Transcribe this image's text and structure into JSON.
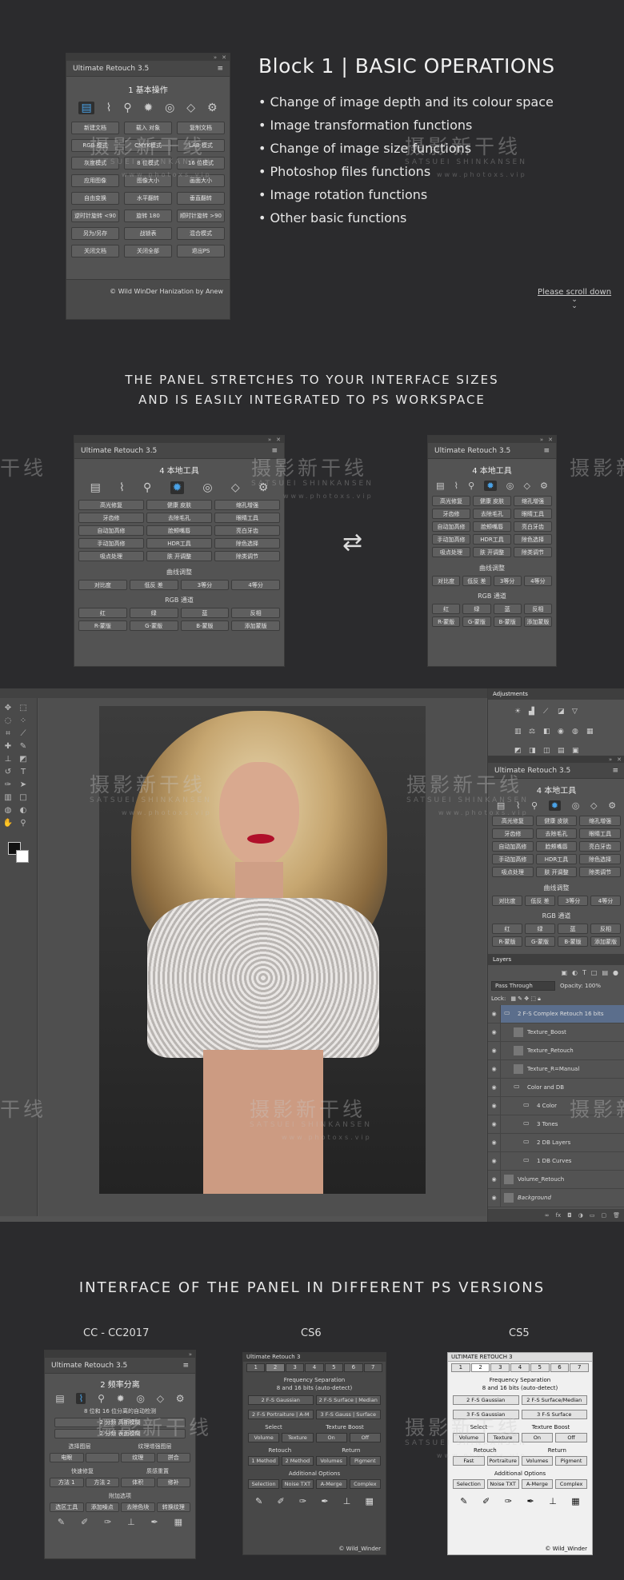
{
  "block1": {
    "panel_title": "Ultimate Retouch 3.5",
    "subtitle": "1 基本操作",
    "buttons": [
      "新建文档",
      "载入 对象",
      "复制文档",
      "RGB 模式",
      "CMYK模式",
      "LAB 模式",
      "灰度模式",
      "8 位模式",
      "16 位模式",
      "应用图像",
      "图像大小",
      "画面大小",
      "自由变换",
      "水平翻转",
      "垂直翻转",
      "逆时针旋转 <90",
      "旋转 180",
      "顺时针旋转 >90",
      "另为/另存",
      "战锁表",
      "混合模式",
      "关闭文档",
      "关闭全部",
      "退出PS"
    ],
    "footer": "© Wild WinDer Hanization by Anew",
    "heading": "Block 1 | BASIC OPERATIONS",
    "bullets": [
      "• Change of image depth  and its colour space",
      "• Image transformation functions",
      "• Change of image size functions",
      "• Photoshop files functions",
      "• Image rotation functions",
      "• Other basic functions"
    ],
    "scroll": "Please scroll down"
  },
  "block2": {
    "heading_1": "THE PANEL STRETCHES TO YOUR INTERFACE SIZES",
    "heading_2": "AND IS EASILY INTEGRATED TO PS WORKSPACE",
    "panel_title": "Ultimate Retouch 3.5",
    "subtitle": "4 本地工具",
    "tools": [
      "高光修复",
      "健康 皮肤",
      "缩孔增强",
      "牙齿修",
      "去除毛孔",
      "眼睛工具",
      "自动加高修",
      "脸颊嘴唇",
      "亮白牙齿",
      "手动加高修",
      "HDR工具",
      "除色选择",
      "吸点处理",
      "肤 开调整",
      "除类调节"
    ],
    "curves": "曲线调整",
    "curve_buttons": [
      "对比度",
      "低反 差",
      "3等分",
      "4等分"
    ],
    "rgb": "RGB 通道",
    "rgb_buttons": [
      "红",
      "绿",
      "蓝",
      "反相",
      "R-蒙版",
      "G-蒙版",
      "B-蒙版",
      "添加蒙版"
    ]
  },
  "block3": {
    "adjustments": "Adjustments",
    "panel_title": "Ultimate Retouch 3.5",
    "subtitle": "4 本地工具",
    "layers_tab": "Layers",
    "blend": "Pass Through",
    "opacity": "Opacity: 100%",
    "lock": "Lock:",
    "fill": "Fill: 100%",
    "layers": [
      "2 F-S Complex Retouch 16 bits",
      "Texture_Boost",
      "Texture_Retouch",
      "Texture_R=Manual",
      "Color and DB",
      "4 Color",
      "3 Tones",
      "2 DB Layers",
      "1 DB Curves",
      "Volume_Retouch",
      "Background"
    ]
  },
  "block4": {
    "heading": "INTERFACE OF THE PANEL IN DIFFERENT PS VERSIONS",
    "versions": [
      "CC - CC2017",
      "CS6",
      "CS5"
    ],
    "cc": {
      "title": "Ultimate Retouch 3.5",
      "subtitle": "2 频率分离",
      "rows": [
        "8 位和 16 位分离的自动检测",
        "2 分频 高斯模糊",
        "2 分频 表面模糊",
        "2 分频 修复模糊",
        "3 分频 表面模糊"
      ],
      "sel": "选择图层",
      "tex": "纹理增强图层",
      "b1": [
        "电眼",
        ""
      ],
      "b2": [
        "纹理",
        "拼合"
      ],
      "fast": "快速修复",
      "vol": "质感重置",
      "b3": [
        "方法 1",
        "方法 2",
        "体积",
        "修补"
      ],
      "extra": "附加选项",
      "b4": [
        "选区工具",
        "添加噪点",
        "去除色块",
        "转换纹理"
      ]
    },
    "cs6": {
      "title": "Ultimate Retouch 3",
      "tabs": [
        "1",
        "2",
        "3",
        "4",
        "5",
        "6",
        "7"
      ],
      "fs": "Frequency Separation",
      "auto": "8 and 16 bits (auto-detect)",
      "r1": [
        "2 F-S Gaussian",
        "2 F-S Surface | Median"
      ],
      "r2": [
        "2 F-S Portraiture | A-M",
        "3 F-S Gauss | Surface"
      ],
      "select": "Select",
      "tboost": "Texture Boost",
      "r3": [
        "Volume",
        "Texture",
        "On",
        "Off"
      ],
      "retouch": "Retouch",
      "ret": "Return",
      "r4": [
        "1 Method",
        "2 Method",
        "Volumes",
        "Pigment"
      ],
      "add": "Additional Options",
      "r5": [
        "Selection",
        "Noise TXT",
        "A-Merge",
        "Complex"
      ],
      "footer": "© Wild_Winder"
    },
    "cs5": {
      "title": "ULTIMATE RETOUCH 3",
      "tabs": [
        "1",
        "2",
        "3",
        "4",
        "5",
        "6",
        "7"
      ],
      "fs": "Frequency Separation",
      "auto": "8 and 16 bits (auto-detect)",
      "r1": [
        "2 F-S Gaussian",
        "2 F-S Surface/Median"
      ],
      "r2": [
        "3 F-S Gaussian",
        "3 F-S Surface"
      ],
      "select": "Select",
      "tboost": "Texture Boost",
      "r3": [
        "Volume",
        "Texture",
        "On",
        "Off"
      ],
      "retouch": "Retouch",
      "ret": "Return",
      "r4": [
        "Fast",
        "Portraiture",
        "Volumes",
        "Pigment"
      ],
      "add": "Additional Options",
      "r5": [
        "Selection",
        "Noise TXT",
        "A-Merge",
        "Complex"
      ],
      "footer": "© Wild_Winder"
    }
  },
  "watermark": {
    "cn": "摄影新干线",
    "en": "SATSUEI SHINKANSEN",
    "url": "www.photoxs.vip",
    "cn_part": "干线",
    "cn_part2": "摄影新干"
  }
}
